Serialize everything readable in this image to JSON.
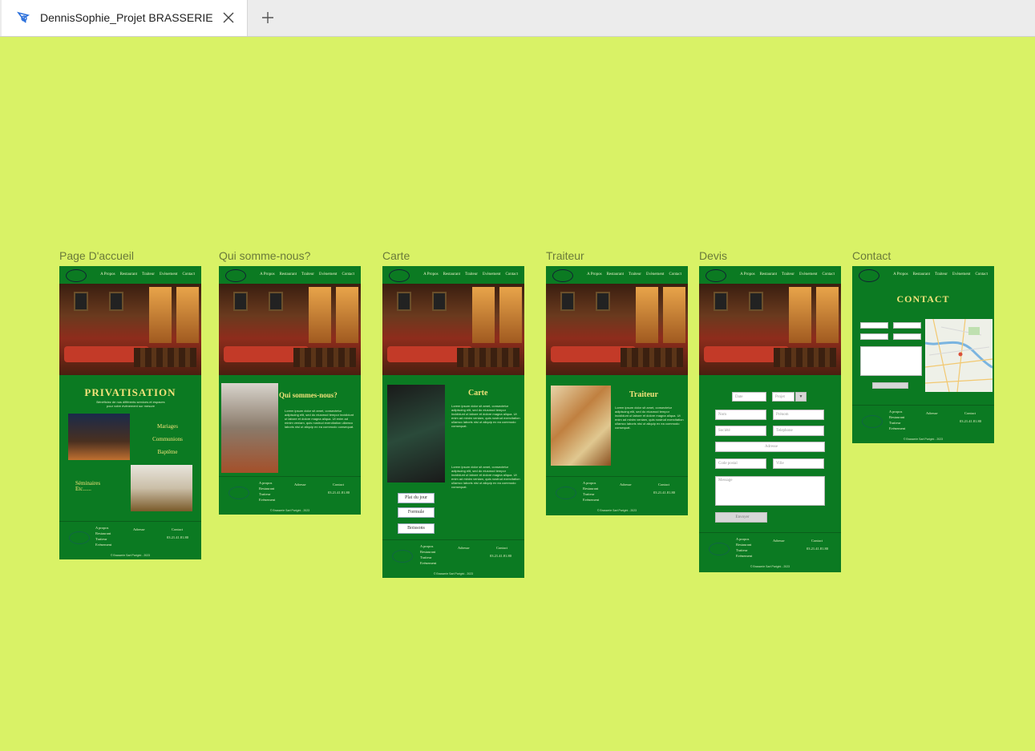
{
  "browser": {
    "tab_title": "DennisSophie_Projet BRASSERIE",
    "new_tab_label": "+"
  },
  "frames": {
    "accueil": {
      "label": "Page D'accueil",
      "hero_title": "PRIVATISATION",
      "intro": "Bénéficiez de nos différents services et espaces pour votre événement sur mesure",
      "services": [
        "Mariages",
        "Communions",
        "Baptême"
      ],
      "services2": [
        "Séminaires",
        "Etc......"
      ]
    },
    "qui": {
      "label": "Qui somme-nous?",
      "heading": "Qui sommes-nous?"
    },
    "carte": {
      "label": "Carte",
      "heading": "Carte",
      "buttons": [
        "Plat du jour",
        "Formule",
        "Boissons"
      ]
    },
    "traiteur": {
      "label": "Traiteur",
      "heading": "Traiteur"
    },
    "devis": {
      "label": "Devis",
      "date": "Date",
      "projet": "Projet",
      "nom": "Nom",
      "prenom": "Prénom",
      "societe": "Société",
      "telephone": "Telephone",
      "adresse": "Adresse",
      "code_postal": "Code postal",
      "ville": "Ville",
      "message": "Message",
      "envoyer": "Envoyer"
    },
    "contact": {
      "label": "Contact",
      "heading": "CONTACT"
    }
  },
  "nav": [
    "A Propos",
    "Restaurant",
    "Traiteur",
    "Evènement",
    "Contact"
  ],
  "footer": {
    "links": [
      "A propos",
      "Restaurant",
      "Traiteur",
      "Evènement"
    ],
    "adresse_title": "Adresse",
    "contact_title": "Contact",
    "phone": "03.21.41.81.80",
    "copyright": "© Brasserie Sart Parigini - 2023"
  },
  "lorem": "Lorem ipsum dolor sit amet, consectetur adipiscing elit, sed do eiusmod tempor incididunt ut labore et dolore magna aliqua. Ut enim ad minim veniam, quis nostrud exercitation ullamco laboris nisi ut aliquip ex ea commodo consequat."
}
